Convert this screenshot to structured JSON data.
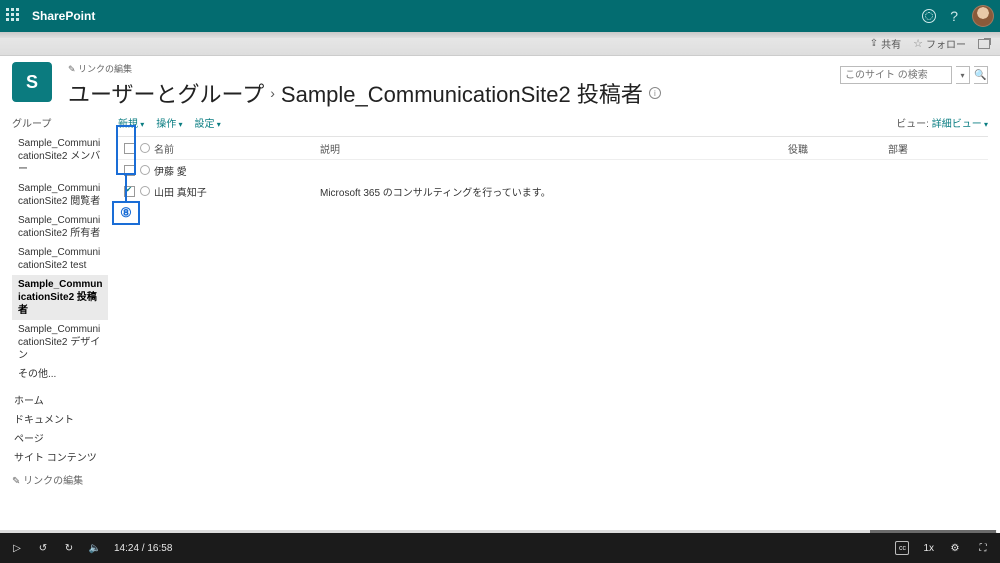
{
  "suite": {
    "app": "SharePoint"
  },
  "cmdbar": {
    "share": "共有",
    "follow": "フォロー"
  },
  "header": {
    "logo_letter": "S",
    "edit_link": "リンクの編集",
    "title_a": "ユーザーとグループ",
    "title_b": "Sample_CommunicationSite2 投稿者"
  },
  "search": {
    "placeholder": "このサイト の検索"
  },
  "nav": {
    "heading": "グループ",
    "items": [
      "Sample_CommunicationSite2 メンバー",
      "Sample_CommunicationSite2 閲覧者",
      "Sample_CommunicationSite2 所有者",
      "Sample_CommunicationSite2 test",
      "Sample_CommunicationSite2 投稿者",
      "Sample_CommunicationSite2 デザイン",
      "その他..."
    ],
    "active_index": 4,
    "links": [
      "ホーム",
      "ドキュメント",
      "ページ",
      "サイト コンテンツ"
    ],
    "edit": "リンクの編集"
  },
  "toolbar": {
    "new": "新規",
    "actions": "操作",
    "settings": "設定",
    "view_label": "ビュー:",
    "view_value": "詳細ビュー"
  },
  "columns": {
    "name": "名前",
    "desc": "説明",
    "role": "役職",
    "dept": "部署"
  },
  "rows": [
    {
      "name": "伊藤 愛",
      "desc": "",
      "checked": false
    },
    {
      "name": "山田 真知子",
      "desc": "Microsoft 365 のコンサルティングを行っています。",
      "checked": true
    }
  ],
  "callout": {
    "number": "⑧"
  },
  "video": {
    "current": "14:24",
    "total": "16:58",
    "progress_pct": 87,
    "speed": "1x"
  }
}
